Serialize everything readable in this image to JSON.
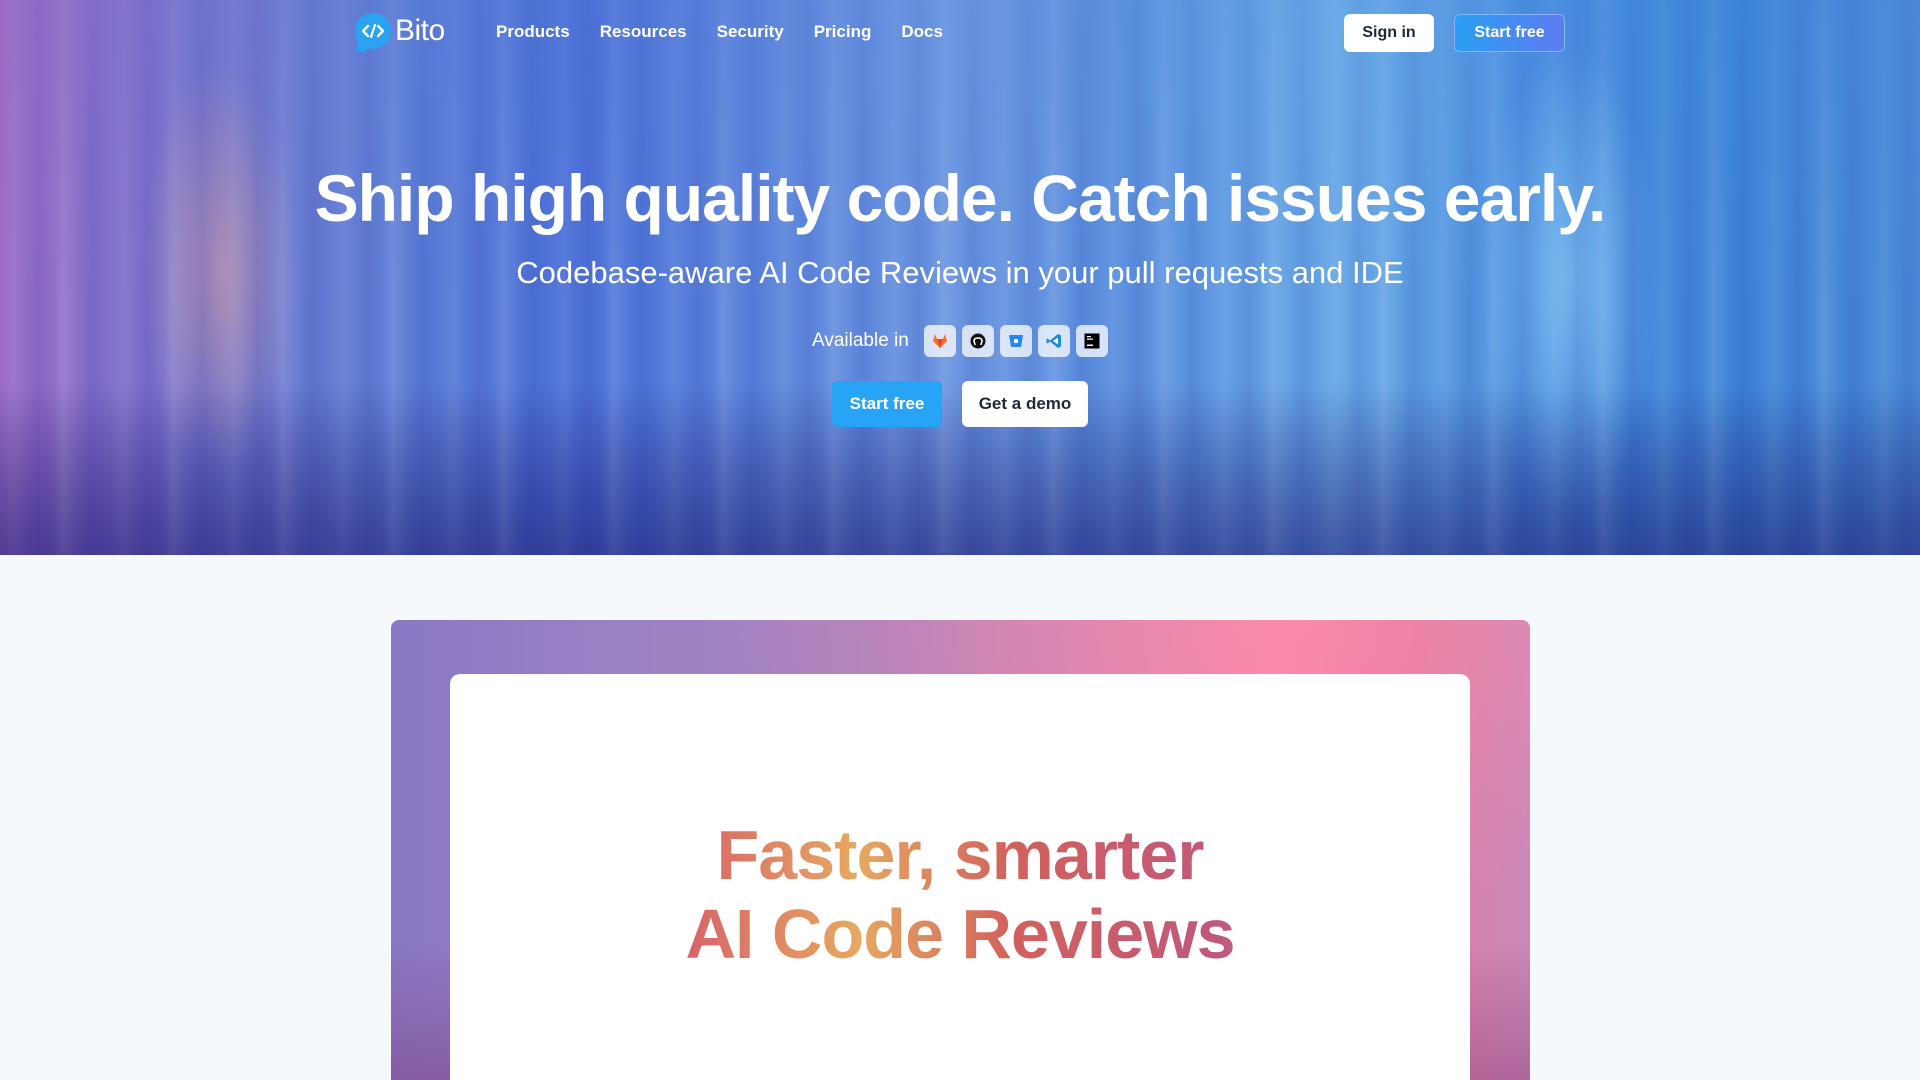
{
  "brand": {
    "name": "Bito",
    "logo_icon": "code-brackets-icon",
    "accent": "#2aa3f3"
  },
  "nav": {
    "links": [
      "Products",
      "Resources",
      "Security",
      "Pricing",
      "Docs"
    ],
    "signin_label": "Sign in",
    "start_label": "Start free"
  },
  "hero": {
    "title": "Ship high quality code. Catch issues early.",
    "subtitle": "Codebase-aware AI Code Reviews in your pull requests and IDE",
    "available_label": "Available in",
    "tools": [
      "gitlab-icon",
      "github-icon",
      "bitbucket-icon",
      "vscode-icon",
      "jetbrains-icon"
    ],
    "start_label": "Start free",
    "demo_label": "Get a demo"
  },
  "showcase": {
    "headline_line1": "Faster, smarter",
    "headline_line2": "AI Code Reviews"
  }
}
